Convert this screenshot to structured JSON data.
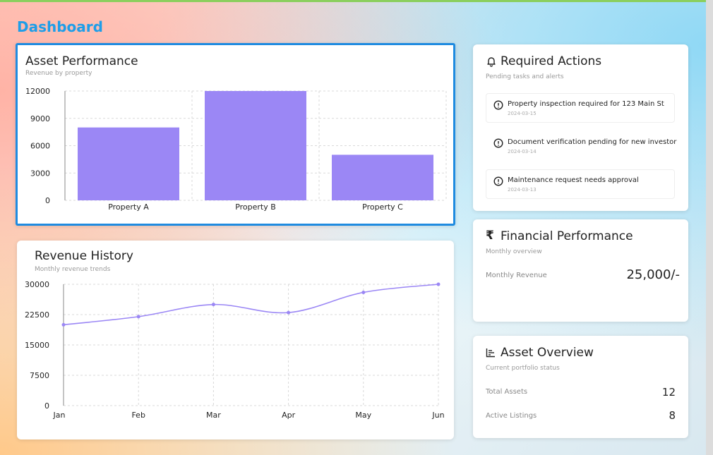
{
  "page": {
    "title": "Dashboard"
  },
  "asset_performance": {
    "title": "Asset Performance",
    "subtitle": "Revenue by property",
    "chart_data": {
      "type": "bar",
      "categories": [
        "Property A",
        "Property B",
        "Property C"
      ],
      "values": [
        8000,
        12000,
        5000
      ],
      "yticks": [
        "12000",
        "9000",
        "6000",
        "3000",
        "0"
      ],
      "ylim": [
        0,
        12000
      ],
      "bar_color": "#9b87f5"
    }
  },
  "revenue_history": {
    "title": "Revenue History",
    "subtitle": "Monthly revenue trends",
    "chart_data": {
      "type": "line",
      "x": [
        "Jan",
        "Feb",
        "Mar",
        "Apr",
        "May",
        "Jun"
      ],
      "values": [
        20000,
        22000,
        25000,
        23000,
        28000,
        30000
      ],
      "yticks": [
        "30000",
        "22500",
        "15000",
        "7500",
        "0"
      ],
      "ylim": [
        0,
        30000
      ],
      "line_color": "#9b87f5"
    }
  },
  "required_actions": {
    "title": "Required Actions",
    "subtitle": "Pending tasks and alerts",
    "icon": "bell-icon",
    "items": [
      {
        "text": "Property inspection required for 123 Main St",
        "date": "2024-03-15"
      },
      {
        "text": "Document verification pending for new investor",
        "date": "2024-03-14"
      },
      {
        "text": "Maintenance request needs approval",
        "date": "2024-03-13"
      }
    ]
  },
  "financial_performance": {
    "title": "Financial Performance",
    "subtitle": "Monthly overview",
    "icon": "rupee-icon",
    "label": "Monthly Revenue",
    "value": "25,000/-"
  },
  "asset_overview": {
    "title": "Asset Overview",
    "subtitle": "Current portfolio status",
    "icon": "bar-chart-icon",
    "rows": [
      {
        "label": "Total Assets",
        "value": "12"
      },
      {
        "label": "Active Listings",
        "value": "8"
      }
    ]
  },
  "colors": {
    "accent": "#1e9ee8",
    "chart": "#9b87f5",
    "focus": "#1f8be0"
  }
}
